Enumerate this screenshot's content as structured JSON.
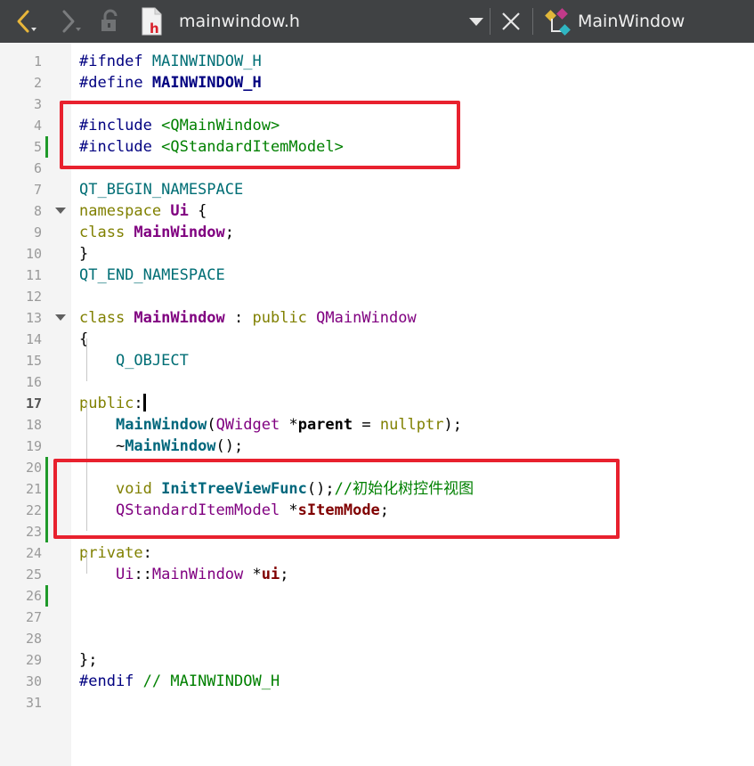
{
  "toolbar": {
    "file_name": "mainwindow.h",
    "symbol_name": "MainWindow",
    "icons": [
      "back-arrow-icon",
      "forward-arrow-icon",
      "lock-icon",
      "header-file-icon",
      "dropdown-icon",
      "close-icon",
      "class-symbol-icon"
    ],
    "header_file_letter": "h"
  },
  "editor": {
    "current_line": 17,
    "lines": [
      {
        "n": "1",
        "tokens": [
          {
            "t": "#ifndef ",
            "c": "pp"
          },
          {
            "t": "MAINWINDOW_H",
            "c": "qtmacro"
          }
        ]
      },
      {
        "n": "2",
        "tokens": [
          {
            "t": "#define ",
            "c": "pp"
          },
          {
            "t": "MAINWINDOW_H",
            "c": "macro bold"
          }
        ]
      },
      {
        "n": "3",
        "tokens": []
      },
      {
        "n": "4",
        "tokens": [
          {
            "t": "#include ",
            "c": "pp"
          },
          {
            "t": "<QMainWindow>",
            "c": "inc"
          }
        ]
      },
      {
        "n": "5",
        "tokens": [
          {
            "t": "#include ",
            "c": "pp"
          },
          {
            "t": "<QStandardItemModel>",
            "c": "inc"
          }
        ]
      },
      {
        "n": "6",
        "tokens": []
      },
      {
        "n": "7",
        "tokens": [
          {
            "t": "QT_BEGIN_NAMESPACE",
            "c": "qtmacro"
          }
        ]
      },
      {
        "n": "8",
        "tokens": [
          {
            "t": "namespace ",
            "c": "kw"
          },
          {
            "t": "Ui",
            "c": "cls"
          },
          {
            "t": " {",
            "c": "plain"
          }
        ]
      },
      {
        "n": "9",
        "tokens": [
          {
            "t": "class ",
            "c": "kw"
          },
          {
            "t": "MainWindow",
            "c": "cls"
          },
          {
            "t": ";",
            "c": "plain"
          }
        ]
      },
      {
        "n": "10",
        "tokens": [
          {
            "t": "}",
            "c": "plain"
          }
        ]
      },
      {
        "n": "11",
        "tokens": [
          {
            "t": "QT_END_NAMESPACE",
            "c": "qtmacro"
          }
        ]
      },
      {
        "n": "12",
        "tokens": []
      },
      {
        "n": "13",
        "tokens": [
          {
            "t": "class ",
            "c": "kw"
          },
          {
            "t": "MainWindow",
            "c": "cls"
          },
          {
            "t": " : ",
            "c": "plain"
          },
          {
            "t": "public ",
            "c": "kw"
          },
          {
            "t": "QMainWindow",
            "c": "type"
          }
        ]
      },
      {
        "n": "14",
        "tokens": [
          {
            "t": "{",
            "c": "plain"
          }
        ]
      },
      {
        "n": "15",
        "tokens": [
          {
            "t": "    ",
            "c": "plain"
          },
          {
            "t": "Q_OBJECT",
            "c": "qtmacro"
          }
        ]
      },
      {
        "n": "16",
        "tokens": []
      },
      {
        "n": "17",
        "tokens": [
          {
            "t": "public",
            "c": "kw"
          },
          {
            "t": ":",
            "c": "plain"
          }
        ]
      },
      {
        "n": "18",
        "tokens": [
          {
            "t": "    ",
            "c": "plain"
          },
          {
            "t": "MainWindow",
            "c": "fn"
          },
          {
            "t": "(",
            "c": "plain"
          },
          {
            "t": "QWidget",
            "c": "type"
          },
          {
            "t": " *",
            "c": "plain"
          },
          {
            "t": "parent",
            "c": "param"
          },
          {
            "t": " = ",
            "c": "plain"
          },
          {
            "t": "nullptr",
            "c": "kw"
          },
          {
            "t": ");",
            "c": "plain"
          }
        ]
      },
      {
        "n": "19",
        "tokens": [
          {
            "t": "    ~",
            "c": "plain"
          },
          {
            "t": "MainWindow",
            "c": "fn"
          },
          {
            "t": "();",
            "c": "plain"
          }
        ]
      },
      {
        "n": "20",
        "tokens": []
      },
      {
        "n": "21",
        "tokens": [
          {
            "t": "    ",
            "c": "plain"
          },
          {
            "t": "void ",
            "c": "kw"
          },
          {
            "t": "InitTreeViewFunc",
            "c": "fn"
          },
          {
            "t": "();",
            "c": "plain"
          },
          {
            "t": "//初始化树控件视图",
            "c": "cmt"
          }
        ]
      },
      {
        "n": "22",
        "tokens": [
          {
            "t": "    ",
            "c": "plain"
          },
          {
            "t": "QStandardItemModel",
            "c": "type"
          },
          {
            "t": " *",
            "c": "plain"
          },
          {
            "t": "sItemMode",
            "c": "member"
          },
          {
            "t": ";",
            "c": "plain"
          }
        ]
      },
      {
        "n": "23",
        "tokens": []
      },
      {
        "n": "24",
        "tokens": [
          {
            "t": "private",
            "c": "kw"
          },
          {
            "t": ":",
            "c": "plain"
          }
        ]
      },
      {
        "n": "25",
        "tokens": [
          {
            "t": "    ",
            "c": "plain"
          },
          {
            "t": "Ui",
            "c": "type"
          },
          {
            "t": "::",
            "c": "plain"
          },
          {
            "t": "MainWindow",
            "c": "type"
          },
          {
            "t": " *",
            "c": "plain"
          },
          {
            "t": "ui",
            "c": "member"
          },
          {
            "t": ";",
            "c": "plain"
          }
        ]
      },
      {
        "n": "26",
        "tokens": []
      },
      {
        "n": "27",
        "tokens": []
      },
      {
        "n": "28",
        "tokens": []
      },
      {
        "n": "29",
        "tokens": [
          {
            "t": "};",
            "c": "plain"
          }
        ]
      },
      {
        "n": "30",
        "tokens": [
          {
            "t": "#endif ",
            "c": "pp"
          },
          {
            "t": "// MAINWINDOW_H",
            "c": "cmt"
          }
        ]
      },
      {
        "n": "31",
        "tokens": []
      }
    ],
    "modified_lines": [
      "5",
      "20",
      "21",
      "22",
      "23",
      "26"
    ],
    "foldable_lines": [
      "8",
      "13"
    ]
  },
  "colors": {
    "toolbar_bg": "#404244",
    "gutter_bg": "#f4f4f4",
    "change_marker": "#1f9a2a",
    "annotation_red": "#e8212e",
    "header_icon_red": "#d8222c"
  }
}
